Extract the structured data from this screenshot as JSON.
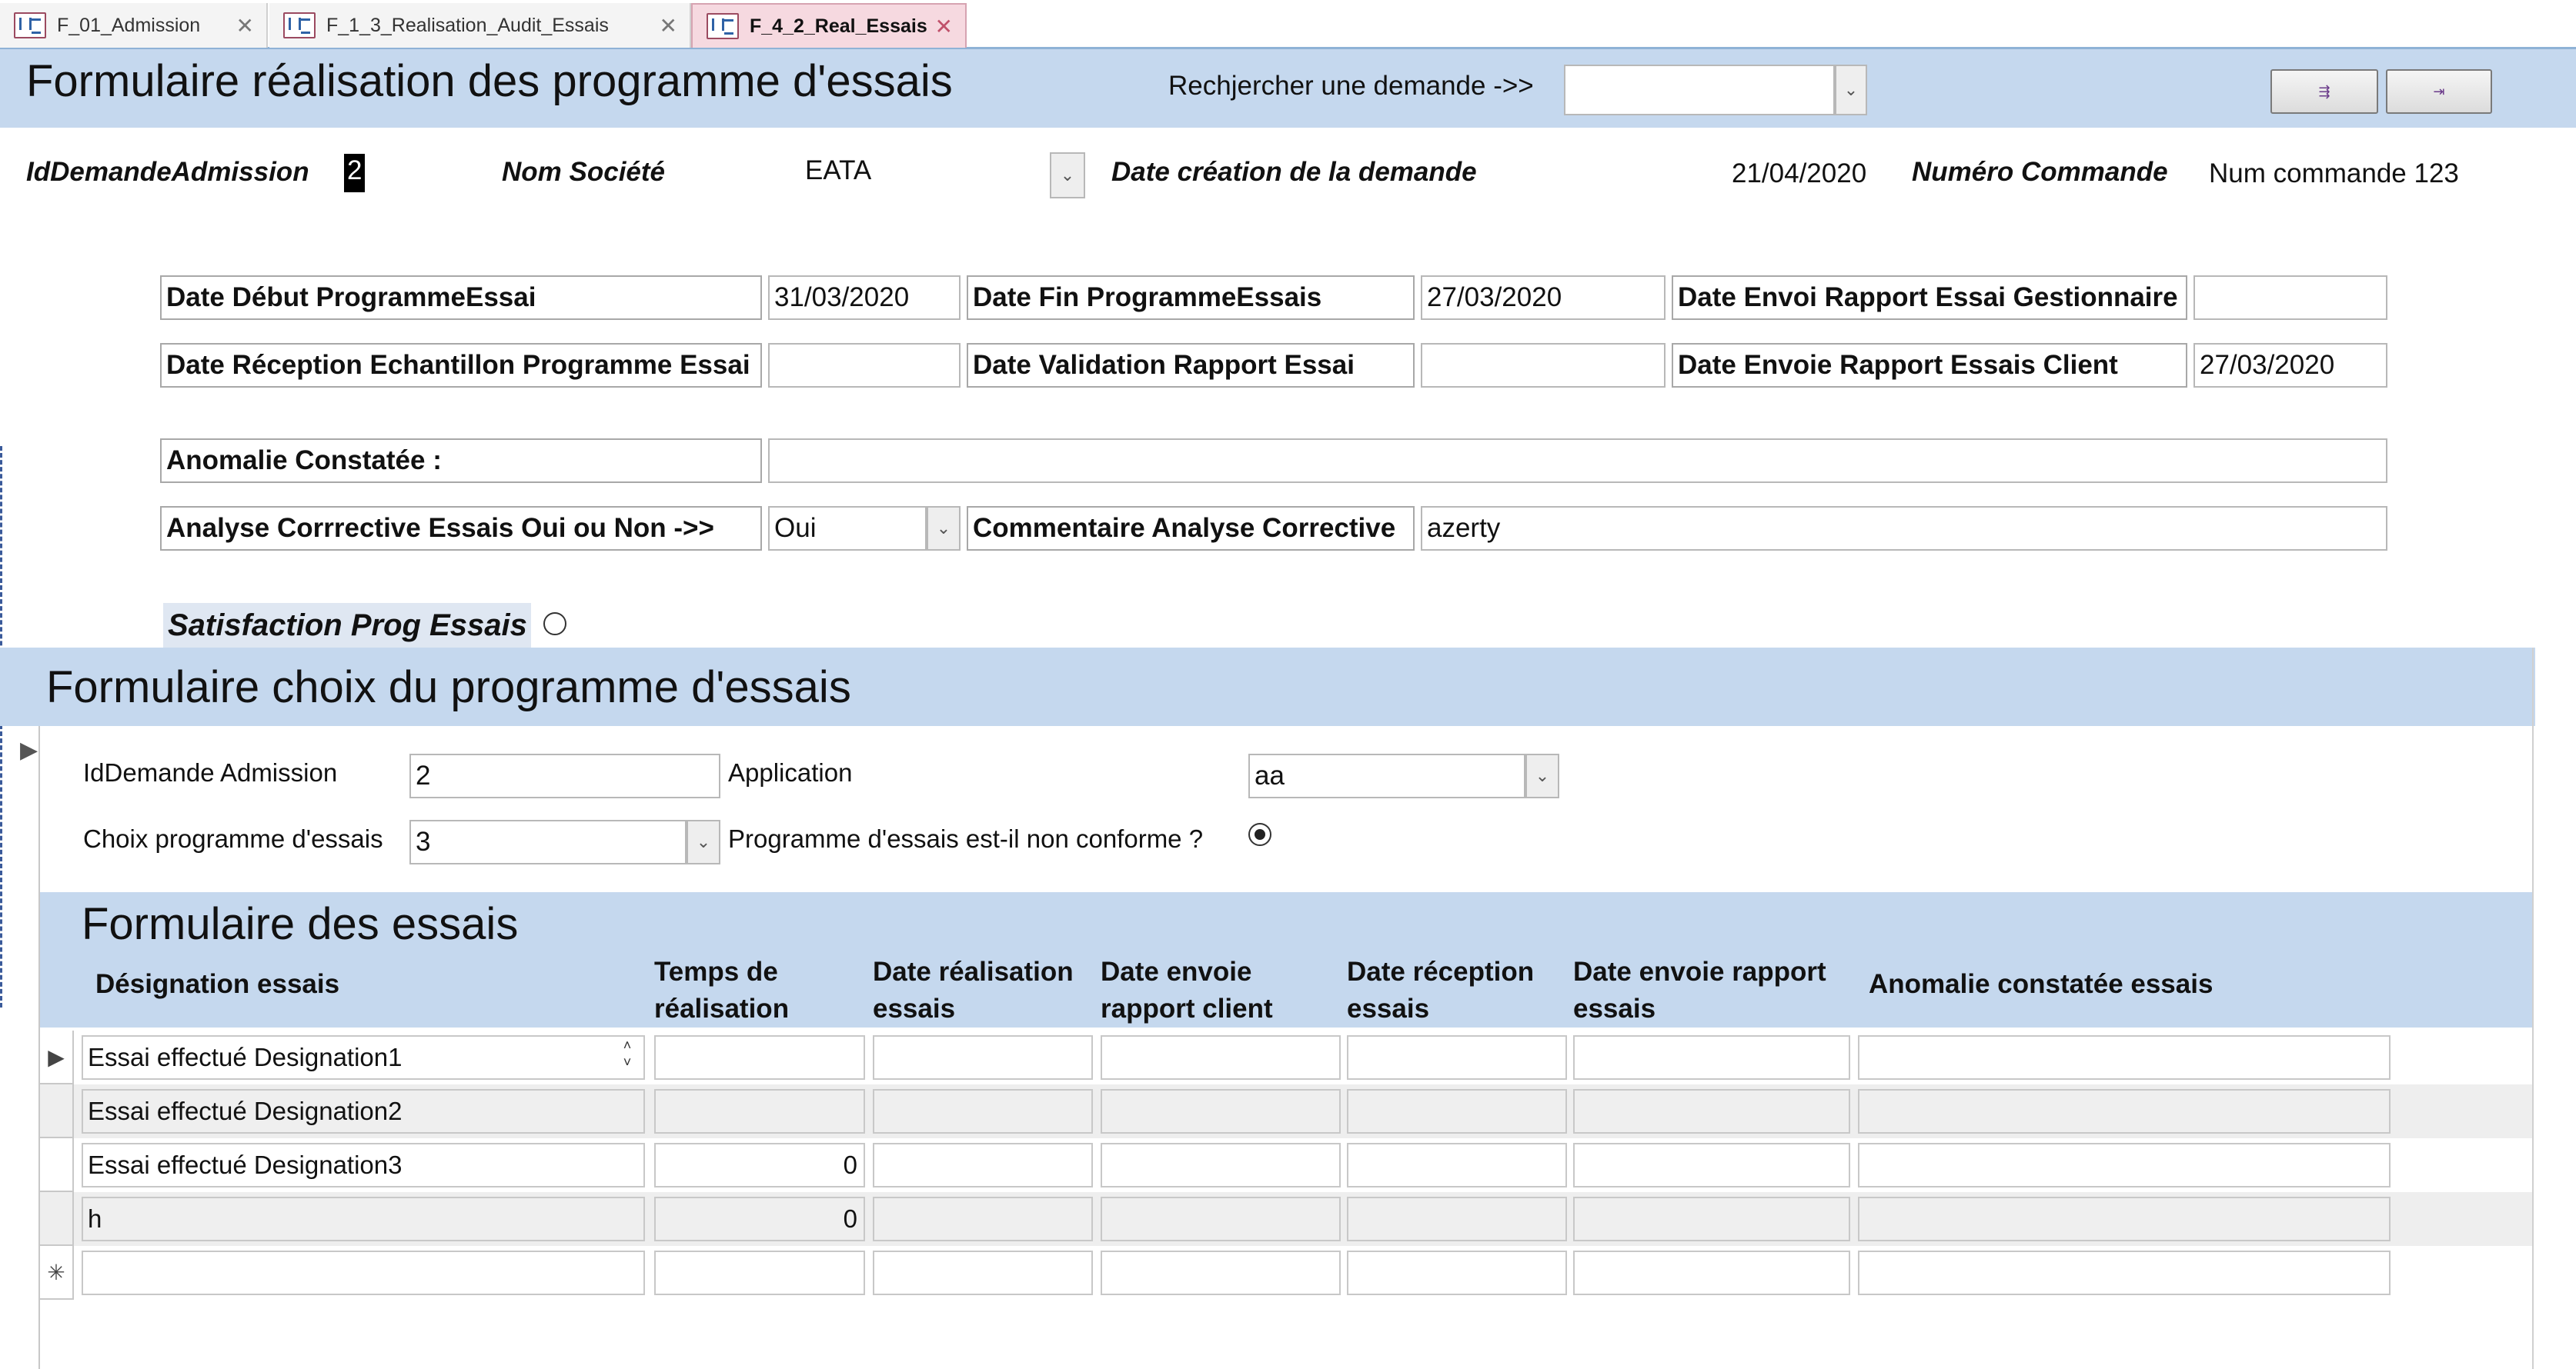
{
  "tabs": [
    {
      "label": "F_01_Admission"
    },
    {
      "label": "F_1_3_Realisation_Audit_Essais"
    },
    {
      "label": "F_4_2_Real_Essais"
    }
  ],
  "header": {
    "title": "Formulaire réalisation des programme d'essais",
    "search_label": "Rechjercher une demande ->>",
    "search_value": ""
  },
  "info": {
    "id_label": "IdDemandeAdmission",
    "id_value": "2",
    "societe_label": "Nom Société",
    "societe_value": "EATA",
    "date_creation_label": "Date création de la demande",
    "date_creation_value": "21/04/2020",
    "commande_label": "Numéro Commande",
    "commande_value": "Num commande 123"
  },
  "fields": {
    "debut_label": "Date Début ProgrammeEssai",
    "debut_value": "31/03/2020",
    "fin_label": "Date Fin ProgrammeEssais",
    "fin_value": "27/03/2020",
    "envoi_gest_label": "Date Envoi Rapport Essai Gestionnaire",
    "envoi_gest_value": "",
    "reception_label": "Date Réception Echantillon Programme Essai",
    "reception_value": "",
    "validation_label": "Date Validation Rapport Essai",
    "validation_value": "",
    "envoie_client_label": "Date Envoie Rapport Essais Client",
    "envoie_client_value": "27/03/2020",
    "anomalie_label": "Anomalie Constatée :",
    "anomalie_value": "",
    "analyse_label": "Analyse Corrrective Essais Oui ou Non ->>",
    "analyse_value": "Oui",
    "commentaire_label": "Commentaire Analyse Corrective",
    "commentaire_value": "azerty",
    "satisfaction_label": "Satisfaction Prog Essais"
  },
  "choix": {
    "title": "Formulaire choix du programme d'essais",
    "id_label": "IdDemande Admission",
    "id_value": "2",
    "application_label": "Application",
    "application_value": "aa",
    "programme_label": "Choix programme d'essais",
    "programme_value": "3",
    "non_conforme_label": "Programme d'essais est-il non conforme ?"
  },
  "essais": {
    "title": "Formulaire des essais",
    "columns": [
      "Désignation essais",
      "Temps de réalisation",
      "Date réalisation essais",
      "Date envoie rapport client",
      "Date réception essais",
      "Date envoie rapport essais",
      "Anomalie constatée essais"
    ],
    "rows": [
      {
        "designation": "Essai effectué Designation1",
        "temps": ""
      },
      {
        "designation": "Essai effectué Designation2",
        "temps": ""
      },
      {
        "designation": "Essai effectué Designation3",
        "temps": "0"
      },
      {
        "designation": "h",
        "temps": "0"
      },
      {
        "designation": "",
        "temps": ""
      }
    ],
    "new_row_marker": "✳"
  }
}
